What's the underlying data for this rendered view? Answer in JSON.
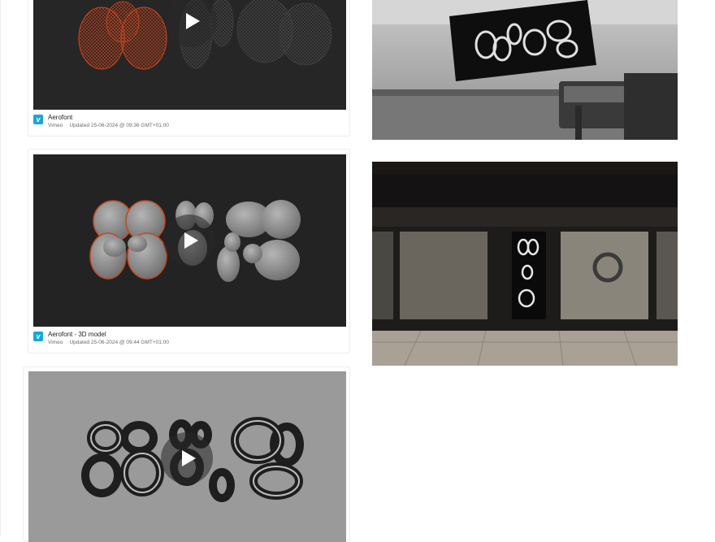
{
  "videos": [
    {
      "title": "Aerofont",
      "source": "Vimeo",
      "updated": "Updated 25-06-2024 @ 09:36 GMT+01:00"
    },
    {
      "title": "Aerofont - 3D model",
      "source": "Vimeo",
      "updated": "Updated 25-06-2024 @ 09:44 GMT+01:00"
    },
    {
      "title": "",
      "source": "",
      "updated": ""
    }
  ],
  "icons": {
    "play": "play-icon",
    "provider": "vimeo-icon"
  },
  "colors": {
    "vimeo_blue": "#17a6d8",
    "wireframe_orange": "#d0461c",
    "dark_bg": "#222222",
    "gray_bg": "#9a9a9a"
  }
}
